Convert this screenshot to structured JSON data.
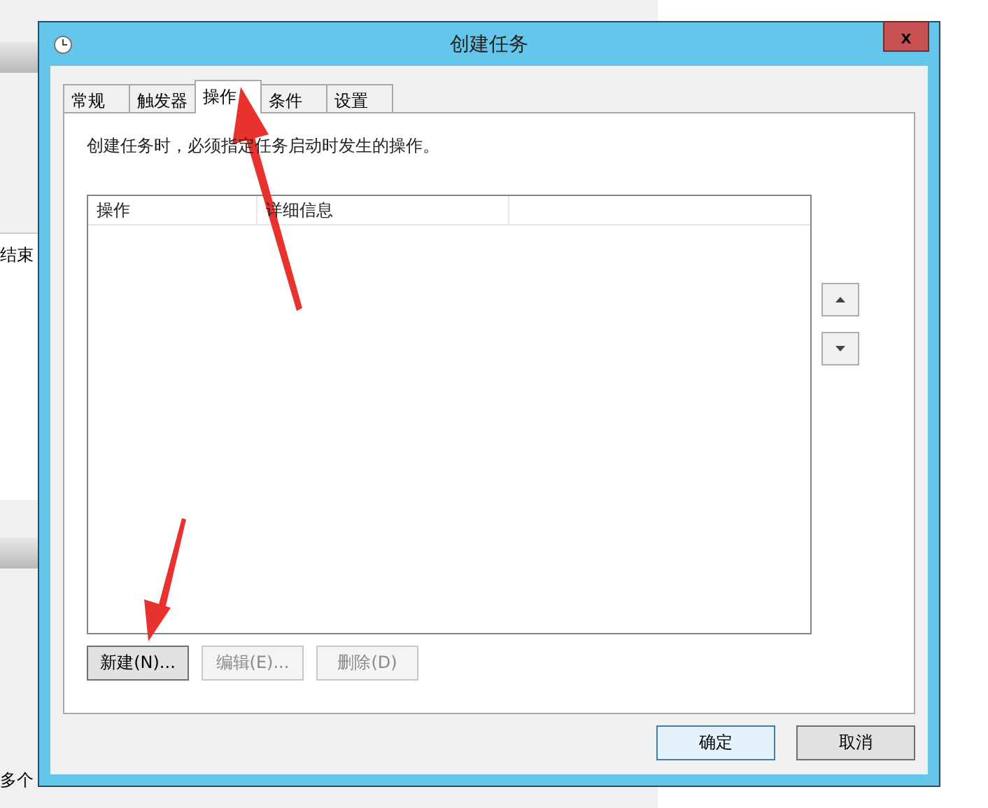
{
  "background_window": {
    "texts": [
      "结束",
      "多个"
    ]
  },
  "dialog": {
    "title": "创建任务",
    "close": "x",
    "tabs": [
      {
        "label": "常规",
        "selected": false
      },
      {
        "label": "触发器",
        "selected": false
      },
      {
        "label": "操作",
        "selected": true
      },
      {
        "label": "条件",
        "selected": false
      },
      {
        "label": "设置",
        "selected": false
      }
    ],
    "description": "创建任务时，必须指定任务启动时发生的操作。",
    "table": {
      "columns": [
        "操作",
        "详细信息"
      ]
    },
    "action_buttons": [
      {
        "label": "新建(N)...",
        "disabled": false
      },
      {
        "label": "编辑(E)...",
        "disabled": true
      },
      {
        "label": "删除(D)",
        "disabled": true
      }
    ],
    "buttons": [
      {
        "label": "确定",
        "default": true
      },
      {
        "label": "取消",
        "default": false
      }
    ]
  }
}
